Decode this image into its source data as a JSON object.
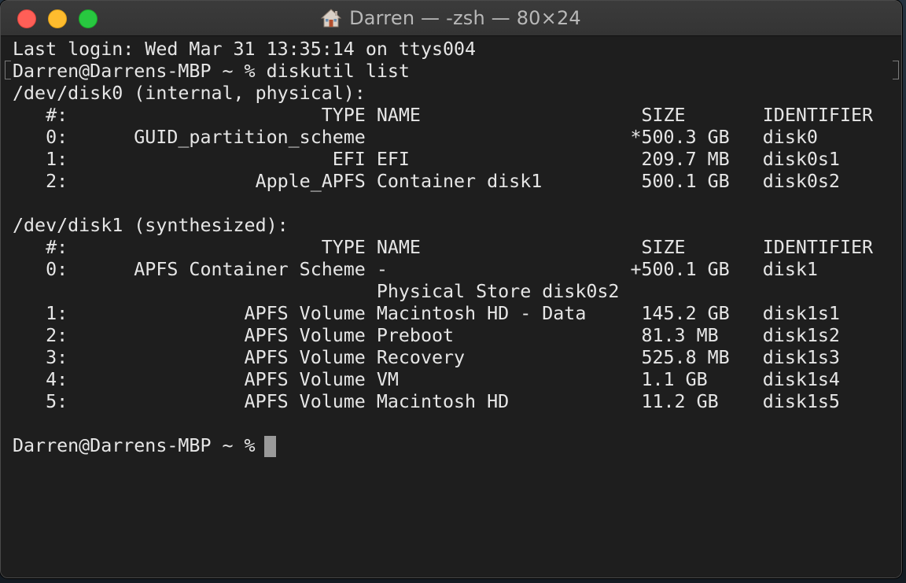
{
  "window": {
    "title": "Darren — -zsh — 80×24",
    "title_icon": "home-folder-icon",
    "controls": {
      "close": {
        "icon": "close-button",
        "color": "#ff5f57"
      },
      "minimize": {
        "icon": "minimize-button",
        "color": "#febc2e"
      },
      "zoom": {
        "icon": "zoom-button",
        "color": "#28c840"
      }
    }
  },
  "terminal": {
    "background": "#1e1e1e",
    "foreground": "#e6e6e6",
    "lines": [
      "Last login: Wed Mar 31 13:35:14 on ttys004",
      "Darren@Darrens-MBP ~ % diskutil list",
      "/dev/disk0 (internal, physical):",
      "   #:                       TYPE NAME                    SIZE       IDENTIFIER",
      "   0:      GUID_partition_scheme                        *500.3 GB   disk0",
      "   1:                        EFI EFI                     209.7 MB   disk0s1",
      "   2:                 Apple_APFS Container disk1         500.1 GB   disk0s2",
      "",
      "/dev/disk1 (synthesized):",
      "   #:                       TYPE NAME                    SIZE       IDENTIFIER",
      "   0:      APFS Container Scheme -                      +500.1 GB   disk1",
      "                                 Physical Store disk0s2",
      "   1:                APFS Volume Macintosh HD - Data     145.2 GB   disk1s1",
      "   2:                APFS Volume Preboot                 81.3 MB    disk1s2",
      "   3:                APFS Volume Recovery                525.8 MB   disk1s3",
      "   4:                APFS Volume VM                      1.1 GB     disk1s4",
      "   5:                APFS Volume Macintosh HD            11.2 GB    disk1s5",
      "",
      "Darren@Darrens-MBP ~ % "
    ]
  }
}
